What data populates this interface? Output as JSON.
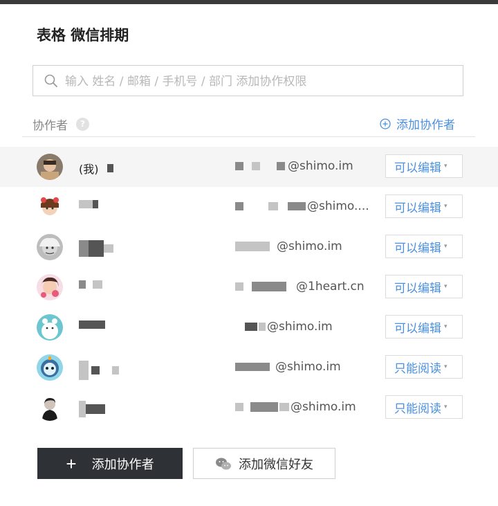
{
  "window_title": "表格 微信排期",
  "search": {
    "placeholder": "输入 姓名 / 邮箱 / 手机号 / 部门 添加协作权限"
  },
  "collaborators_header": {
    "label": "协作者",
    "help_icon": "question-icon",
    "add_link_label": "添加协作者"
  },
  "collaborators": [
    {
      "name": "(我)",
      "email": "@shimo.im",
      "permission": "可以编辑"
    },
    {
      "name": "",
      "email": "@shimo....",
      "permission": "可以编辑"
    },
    {
      "name": "",
      "email": "@shimo.im",
      "permission": "可以编辑"
    },
    {
      "name": "",
      "email": "@1heart.cn",
      "permission": "可以编辑"
    },
    {
      "name": "",
      "email": "@shimo.im",
      "permission": "可以编辑"
    },
    {
      "name": "",
      "email": "@shimo.im",
      "permission": "只能阅读"
    },
    {
      "name": "",
      "email": "@shimo.im",
      "permission": "只能阅读"
    }
  ],
  "footer": {
    "add_button_label": "添加协作者",
    "wechat_button_label": "添加微信好友"
  },
  "colors": {
    "accent": "#4a90e2",
    "dark_button": "#2e3135",
    "self_row_bg": "#f5f5f5"
  }
}
